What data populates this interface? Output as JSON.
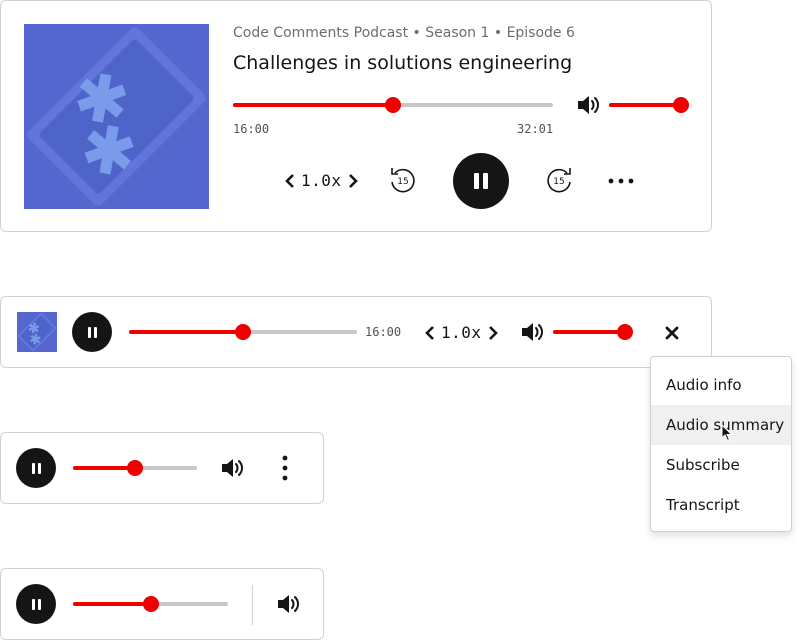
{
  "player_full": {
    "meta": "Code Comments Podcast • Season 1 • Episode 6",
    "title": "Challenges in solutions engineering",
    "progress": 0.5,
    "volume": 1.0,
    "current_time": "16:00",
    "duration": "32:01",
    "playback_rate": "1.0x",
    "skip_back_seconds": "15",
    "skip_forward_seconds": "15",
    "state": "playing"
  },
  "player_compact": {
    "progress": 0.5,
    "current_time": "16:00",
    "playback_rate": "1.0x",
    "volume": 1.0,
    "state": "playing"
  },
  "player_mini_1": {
    "progress": 0.5,
    "state": "playing"
  },
  "player_mini_2": {
    "progress": 0.5,
    "state": "playing"
  },
  "overflow_menu": {
    "items": [
      {
        "label": "Audio info"
      },
      {
        "label": "Audio summary"
      },
      {
        "label": "Subscribe"
      },
      {
        "label": "Transcript"
      }
    ],
    "hovered_index": 1
  },
  "colors": {
    "accent": "#ee0000",
    "track": "#c7c7c7",
    "dark": "#151515",
    "border": "#d2d2d2",
    "artwork": "#5562c8"
  },
  "icons": [
    "pause-icon",
    "volume-icon",
    "skip-back-15-icon",
    "skip-forward-15-icon",
    "more-horizontal-icon",
    "more-vertical-icon",
    "close-icon",
    "chevron-left-icon",
    "chevron-right-icon"
  ]
}
